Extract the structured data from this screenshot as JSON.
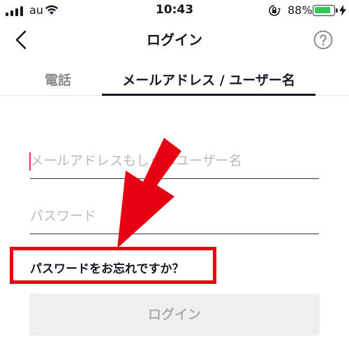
{
  "status_bar": {
    "carrier": "au",
    "time": "10:43",
    "battery_percent": "88%",
    "battery_level": 0.88,
    "signal_icon": "signal-bars-icon",
    "wifi_icon": "wifi-icon",
    "lock_icon": "orientation-lock-icon",
    "charging_icon": "charging-bolt-icon"
  },
  "nav": {
    "title": "ログイン",
    "back_icon": "chevron-left-icon",
    "help_icon": "help-circle-icon"
  },
  "tabs": [
    {
      "label": "電話",
      "active": false
    },
    {
      "label": "メールアドレス / ユーザー名",
      "active": true
    }
  ],
  "form": {
    "email_placeholder": "メールアドレスもしくはユーザー名",
    "email_value": "",
    "password_placeholder": "パスワード",
    "password_value": "",
    "forgot_password": "パスワードをお忘れですか？",
    "login_button": "ログイン"
  },
  "annotation": {
    "arrow_color": "#e60012",
    "highlight_color": "#e60012"
  },
  "colors": {
    "accent_caret": "#fe2c55",
    "text_primary": "#161823",
    "text_secondary": "#8a8b91",
    "button_disabled_bg": "#efeff0",
    "button_disabled_text": "#acadb1",
    "battery_green": "#34c759"
  }
}
